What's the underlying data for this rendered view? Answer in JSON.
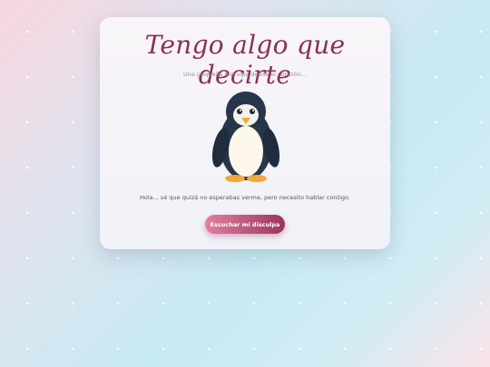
{
  "card": {
    "title": "Tengo algo que decirte",
    "subtitle": "Una pequeña disculpa desde el corazón...",
    "message": "Hola... sé que quizá no esperabas verme, pero necesito hablar contigo.",
    "button_label": "Escuchar mi disculpa"
  },
  "mascot": {
    "icon": "penguin-icon"
  },
  "colors": {
    "title": "#8a2f55",
    "button_start": "#e17f9c",
    "button_end": "#9c3560",
    "penguin_body": "#27364a",
    "penguin_belly": "#fdf8ea",
    "penguin_feet": "#f2a93b"
  }
}
